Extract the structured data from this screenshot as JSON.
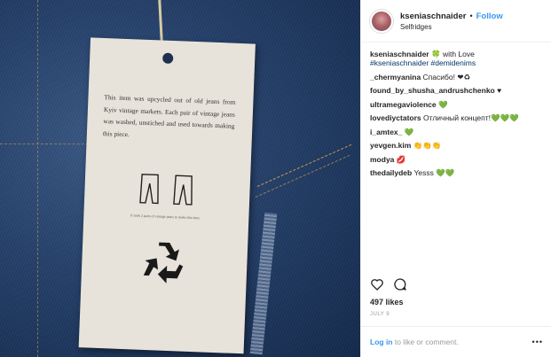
{
  "photo": {
    "tag_text": "This item was upcycled out of old jeans from Kyiv vintage markets. Each pair of vintage jeans was washed, unstiched and used towards making this piece.",
    "tag_small": "It took 2 pairs of vintage jeans to make this item."
  },
  "header": {
    "username": "kseniaschnaider",
    "separator": "•",
    "follow_label": "Follow",
    "location": "Selfridges"
  },
  "comments": [
    {
      "user": "kseniaschnaider",
      "text": "🍀 with Love",
      "tags": "#kseniaschnaider #demidenims"
    },
    {
      "user": "_chermyanina",
      "text": "Спасибо! ❤♻"
    },
    {
      "user": "found_by_shusha_andrushchenko",
      "text": "♥"
    },
    {
      "user": "ultramegaviolence",
      "text": "💚"
    },
    {
      "user": "lovediyctators",
      "text": "Отличный концепт!💚💚💚"
    },
    {
      "user": "i_amtex_",
      "text": "💚"
    },
    {
      "user": "yevgen.kim",
      "text": "👏👏👏"
    },
    {
      "user": "modya",
      "text": "💋"
    },
    {
      "user": "thedailydeb",
      "text": "Yesss 💚💚"
    }
  ],
  "likes": "497 likes",
  "date": "JULY 9",
  "footer": {
    "login_label": "Log in",
    "login_rest": " to like or comment.",
    "more": "•••"
  },
  "colors": {
    "link": "#3897f0",
    "hashtag": "#003569",
    "denim": "#25406a"
  }
}
